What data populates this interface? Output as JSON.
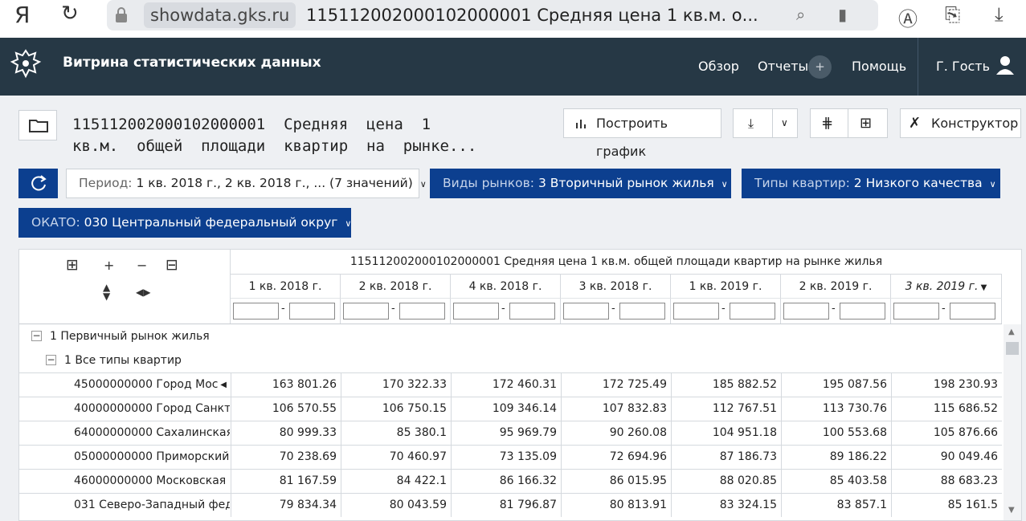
{
  "browser": {
    "ya": "Я",
    "host": "showdata.gks.ru",
    "tab_title": "115112002000102000001 Средняя цена 1 кв.м. о..."
  },
  "header": {
    "site_title": "Витрина статистических данных",
    "nav": {
      "overview": "Обзор",
      "reports": "Отчеты",
      "help": "Помощь",
      "user": "Г. Гость"
    },
    "bg_color": "#263845"
  },
  "toolbar": {
    "title_line1": "115112002000102000001  Средняя  цена  1",
    "title_line2": "кв.м.  общей  площади  квартир  на  рынке...",
    "chart_btn": "Построить график",
    "constructor_btn": "Конструктор"
  },
  "filters": {
    "period_key": "Период:",
    "period_val": "1 кв. 2018 г., 2 кв. 2018 г., ... (7 значений)",
    "markets_key": "Виды рынков:",
    "markets_val": "3 Вторичный рынок жилья",
    "types_key": "Типы квартир:",
    "types_val": "2 Низкого качества",
    "okato_key": "ОКАТО:",
    "okato_val": "030 Центральный федеральный округ",
    "accent_color": "#0c3f8f"
  },
  "table": {
    "header": "115112002000102000001 Средняя цена 1 кв.м. общей площади квартир на рынке жилья",
    "columns": [
      "1 кв. 2018 г.",
      "2 кв. 2018 г.",
      "4 кв. 2018 г.",
      "3 кв. 2018 г.",
      "1 кв. 2019 г.",
      "2 кв. 2019 г.",
      "3 кв. 2019 г."
    ],
    "group1": "1 Первичный рынок жилья",
    "group2": "1 Все типы квартир",
    "rows": [
      {
        "label": "45000000000 Город Мос",
        "values": [
          "163 801.26",
          "170 322.33",
          "172 460.31",
          "172 725.49",
          "185 882.52",
          "195 087.56",
          "198 230.93"
        ]
      },
      {
        "label": "40000000000 Город Санкт",
        "values": [
          "106 570.55",
          "106 750.15",
          "109 346.14",
          "107 832.83",
          "112 767.51",
          "113 730.76",
          "115 686.52"
        ]
      },
      {
        "label": "64000000000 Сахалинская",
        "values": [
          "80 999.33",
          "85 380.1",
          "95 969.79",
          "90 260.08",
          "104 951.18",
          "100 553.68",
          "105 876.66"
        ]
      },
      {
        "label": "05000000000 Приморский",
        "values": [
          "70 238.69",
          "70 460.97",
          "73 135.09",
          "72 694.96",
          "87 186.73",
          "89 186.22",
          "90 049.46"
        ]
      },
      {
        "label": "46000000000 Московская",
        "values": [
          "81 167.59",
          "84 422.1",
          "86 166.32",
          "86 015.95",
          "88 020.85",
          "85 403.58",
          "88 683.23"
        ]
      },
      {
        "label": "031 Северо-Западный фед",
        "values": [
          "79 834.34",
          "80 043.59",
          "81 796.87",
          "80 813.91",
          "83 324.15",
          "83 857.1",
          "85 161.5"
        ]
      }
    ]
  }
}
